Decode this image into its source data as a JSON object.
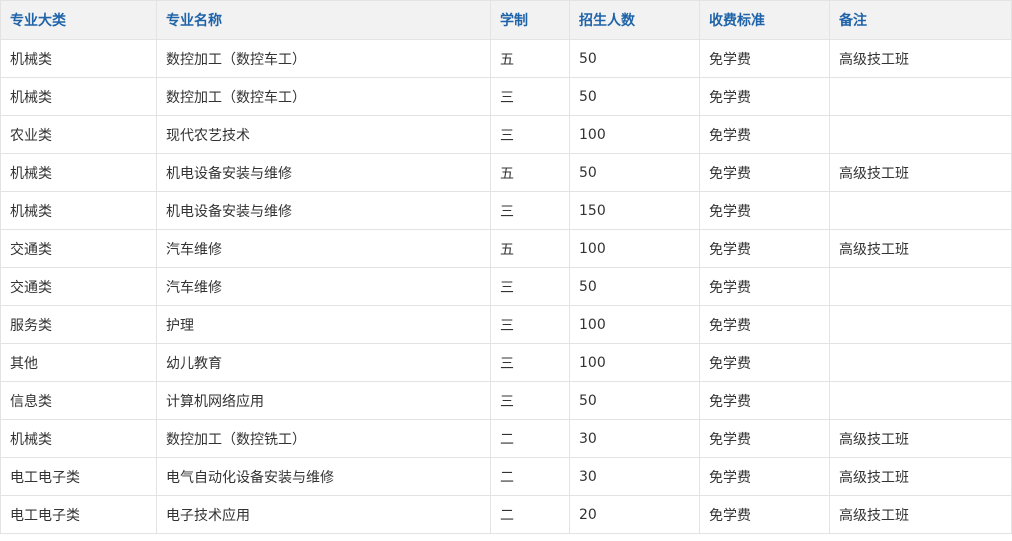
{
  "table": {
    "headers": [
      "专业大类",
      "专业名称",
      "学制",
      "招生人数",
      "收费标准",
      "备注"
    ],
    "rows": [
      [
        "机械类",
        "数控加工（数控车工）",
        "五",
        "50",
        "免学费",
        "高级技工班"
      ],
      [
        "机械类",
        "数控加工（数控车工）",
        "三",
        "50",
        "免学费",
        ""
      ],
      [
        "农业类",
        "现代农艺技术",
        "三",
        "100",
        "免学费",
        ""
      ],
      [
        "机械类",
        "机电设备安装与维修",
        "五",
        "50",
        "免学费",
        "高级技工班"
      ],
      [
        "机械类",
        "机电设备安装与维修",
        "三",
        "150",
        "免学费",
        ""
      ],
      [
        "交通类",
        "汽车维修",
        "五",
        "100",
        "免学费",
        "高级技工班"
      ],
      [
        "交通类",
        "汽车维修",
        "三",
        "50",
        "免学费",
        ""
      ],
      [
        "服务类",
        "护理",
        "三",
        "100",
        "免学费",
        ""
      ],
      [
        "其他",
        "幼儿教育",
        "三",
        "100",
        "免学费",
        ""
      ],
      [
        "信息类",
        "计算机网络应用",
        "三",
        "50",
        "免学费",
        ""
      ],
      [
        "机械类",
        "数控加工（数控铣工）",
        "二",
        "30",
        "免学费",
        "高级技工班"
      ],
      [
        "电工电子类",
        "电气自动化设备安装与维修",
        "二",
        "30",
        "免学费",
        "高级技工班"
      ],
      [
        "电工电子类",
        "电子技术应用",
        "二",
        "20",
        "免学费",
        "高级技工班"
      ]
    ]
  }
}
